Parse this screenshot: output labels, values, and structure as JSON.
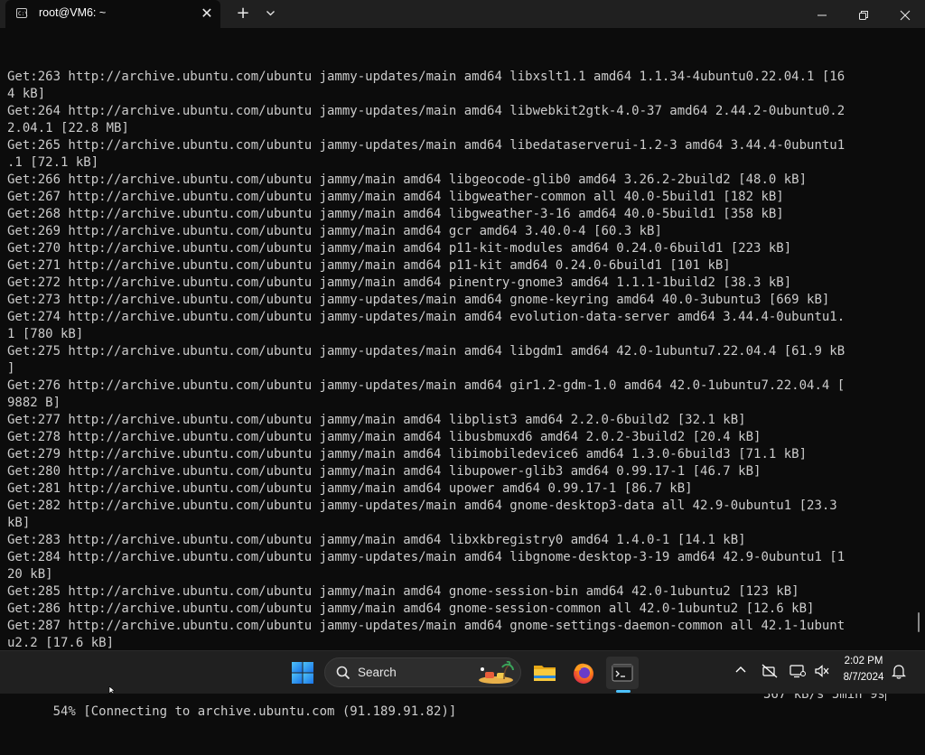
{
  "window": {
    "tab_title": "root@VM6: ~",
    "tab_icon_text": "C:\\",
    "tab_close_glyph": "✕",
    "new_tab_glyph": "+",
    "dropdown_icon": "chevron-down-icon",
    "minimize_icon": "minimize-icon",
    "maximize_icon": "restore-icon",
    "close_icon": "close-icon"
  },
  "terminal": {
    "lines": [
      "Get:263 http://archive.ubuntu.com/ubuntu jammy-updates/main amd64 libxslt1.1 amd64 1.1.34-4ubuntu0.22.04.1 [16",
      "4 kB]",
      "Get:264 http://archive.ubuntu.com/ubuntu jammy-updates/main amd64 libwebkit2gtk-4.0-37 amd64 2.44.2-0ubuntu0.2",
      "2.04.1 [22.8 MB]",
      "Get:265 http://archive.ubuntu.com/ubuntu jammy-updates/main amd64 libedataserverui-1.2-3 amd64 3.44.4-0ubuntu1",
      ".1 [72.1 kB]",
      "Get:266 http://archive.ubuntu.com/ubuntu jammy/main amd64 libgeocode-glib0 amd64 3.26.2-2build2 [48.0 kB]",
      "Get:267 http://archive.ubuntu.com/ubuntu jammy/main amd64 libgweather-common all 40.0-5build1 [182 kB]",
      "Get:268 http://archive.ubuntu.com/ubuntu jammy/main amd64 libgweather-3-16 amd64 40.0-5build1 [358 kB]",
      "Get:269 http://archive.ubuntu.com/ubuntu jammy/main amd64 gcr amd64 3.40.0-4 [60.3 kB]",
      "Get:270 http://archive.ubuntu.com/ubuntu jammy/main amd64 p11-kit-modules amd64 0.24.0-6build1 [223 kB]",
      "Get:271 http://archive.ubuntu.com/ubuntu jammy/main amd64 p11-kit amd64 0.24.0-6build1 [101 kB]",
      "Get:272 http://archive.ubuntu.com/ubuntu jammy/main amd64 pinentry-gnome3 amd64 1.1.1-1build2 [38.3 kB]",
      "Get:273 http://archive.ubuntu.com/ubuntu jammy-updates/main amd64 gnome-keyring amd64 40.0-3ubuntu3 [669 kB]",
      "Get:274 http://archive.ubuntu.com/ubuntu jammy-updates/main amd64 evolution-data-server amd64 3.44.4-0ubuntu1.",
      "1 [780 kB]",
      "Get:275 http://archive.ubuntu.com/ubuntu jammy-updates/main amd64 libgdm1 amd64 42.0-1ubuntu7.22.04.4 [61.9 kB",
      "]",
      "Get:276 http://archive.ubuntu.com/ubuntu jammy-updates/main amd64 gir1.2-gdm-1.0 amd64 42.0-1ubuntu7.22.04.4 [",
      "9882 B]",
      "Get:277 http://archive.ubuntu.com/ubuntu jammy/main amd64 libplist3 amd64 2.2.0-6build2 [32.1 kB]",
      "Get:278 http://archive.ubuntu.com/ubuntu jammy/main amd64 libusbmuxd6 amd64 2.0.2-3build2 [20.4 kB]",
      "Get:279 http://archive.ubuntu.com/ubuntu jammy/main amd64 libimobiledevice6 amd64 1.3.0-6build3 [71.1 kB]",
      "Get:280 http://archive.ubuntu.com/ubuntu jammy/main amd64 libupower-glib3 amd64 0.99.17-1 [46.7 kB]",
      "Get:281 http://archive.ubuntu.com/ubuntu jammy/main amd64 upower amd64 0.99.17-1 [86.7 kB]",
      "Get:282 http://archive.ubuntu.com/ubuntu jammy-updates/main amd64 gnome-desktop3-data all 42.9-0ubuntu1 [23.3",
      "kB]",
      "Get:283 http://archive.ubuntu.com/ubuntu jammy/main amd64 libxkbregistry0 amd64 1.4.0-1 [14.1 kB]",
      "Get:284 http://archive.ubuntu.com/ubuntu jammy-updates/main amd64 libgnome-desktop-3-19 amd64 42.9-0ubuntu1 [1",
      "20 kB]",
      "Get:285 http://archive.ubuntu.com/ubuntu jammy/main amd64 gnome-session-bin amd64 42.0-1ubuntu2 [123 kB]",
      "Get:286 http://archive.ubuntu.com/ubuntu jammy/main amd64 gnome-session-common all 42.0-1ubuntu2 [12.6 kB]",
      "Get:287 http://archive.ubuntu.com/ubuntu jammy-updates/main amd64 gnome-settings-daemon-common all 42.1-1ubunt",
      "u2.2 [17.6 kB]"
    ],
    "progress_left": "54% [Connecting to archive.ubuntu.com (91.189.91.82)]",
    "progress_right": "367 kB/s 5min 9s"
  },
  "taskbar": {
    "start_icon": "windows-start-icon",
    "search_label": "Search",
    "search_icon": "search-icon",
    "pinned_apps": [
      "file-explorer-icon",
      "firefox-icon",
      "terminal-icon"
    ],
    "tray_icons": [
      "chevron-up-icon",
      "network-disconnected-icon",
      "display-icon",
      "volume-icon",
      "notification-bell-icon"
    ],
    "clock_time": "2:02 PM",
    "clock_date": "8/7/2024"
  },
  "colors": {
    "terminal_bg": "#0c0c0c",
    "terminal_fg": "#cccccc",
    "taskbar_bg": "#202020",
    "accent": "#4cc2ff"
  }
}
